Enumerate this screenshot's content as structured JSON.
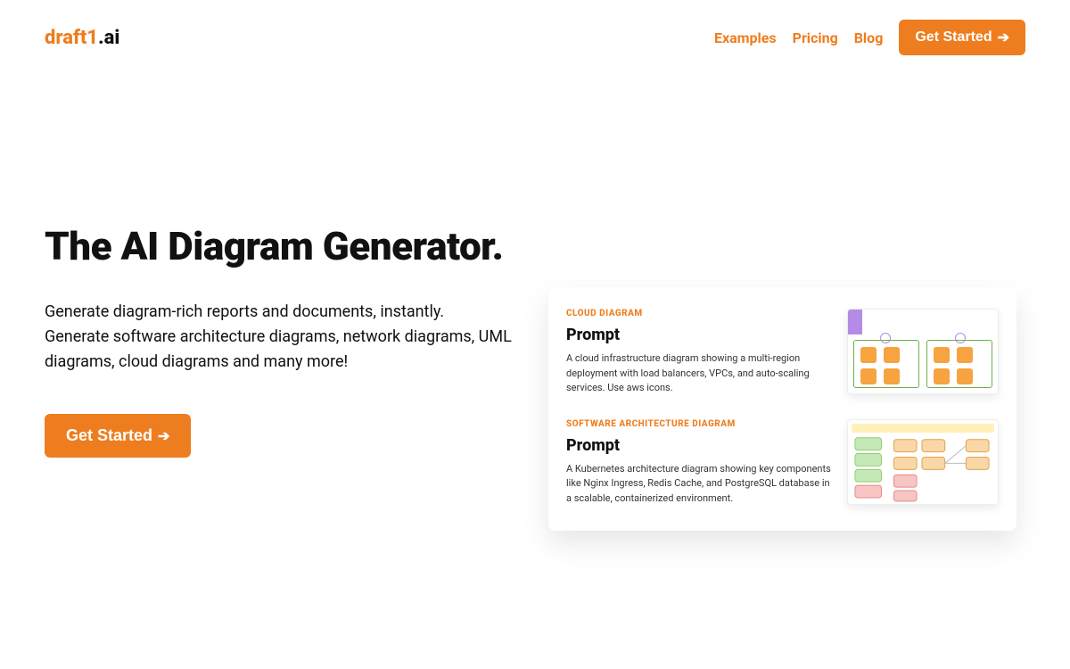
{
  "logo": {
    "part1": "draft1",
    "part2": ".ai"
  },
  "nav": {
    "examples": "Examples",
    "pricing": "Pricing",
    "blog": "Blog",
    "get_started": "Get Started",
    "arrow": "➔"
  },
  "hero": {
    "headline": "The AI Diagram Generator.",
    "sub1": "Generate diagram-rich reports and documents, instantly.",
    "sub2": "Generate software architecture diagrams, network diagrams, UML diagrams, cloud diagrams and many more!",
    "cta": "Get Started",
    "cta_arrow": "➔"
  },
  "examples": [
    {
      "tag": "CLOUD DIAGRAM",
      "title": "Prompt",
      "desc": "A cloud infrastructure diagram showing a multi-region deployment with load balancers, VPCs, and auto-scaling services. Use aws icons."
    },
    {
      "tag": "SOFTWARE ARCHITECTURE DIAGRAM",
      "title": "Prompt",
      "desc": "A Kubernetes architecture diagram showing key components like Nginx Ingress, Redis Cache, and PostgreSQL database in a scalable, containerized environment."
    }
  ]
}
